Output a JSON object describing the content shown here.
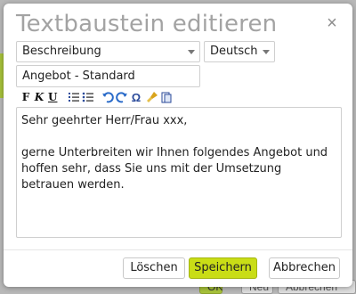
{
  "background": {
    "buttons": {
      "ok": "OK",
      "new": "Neu",
      "cancel": "Abbrechen"
    }
  },
  "dialog": {
    "title": "Textbaustein editieren",
    "close_glyph": "×",
    "field_select": {
      "value": "Beschreibung"
    },
    "language_select": {
      "value": "Deutsch"
    },
    "name_input": {
      "value": "Angebot - Standard"
    },
    "toolbar": {
      "bold": "F",
      "italic": "K",
      "underline": "U",
      "special_chars": "Ω",
      "icons": [
        "bold-icon",
        "italic-icon",
        "underline-icon",
        "ordered-list-icon",
        "bullet-list-icon",
        "undo-icon",
        "redo-icon",
        "special-char-icon",
        "clean-format-icon",
        "paste-icon"
      ]
    },
    "editor": {
      "line1": "Sehr geehrter Herr/Frau xxx,",
      "paragraph2": "gerne Unterbreiten wir Ihnen folgendes Angebot und hoffen sehr, dass Sie uns mit der Umsetzung betrauen werden."
    },
    "buttons": {
      "delete": "Löschen",
      "save": "Speichern",
      "cancel": "Abbrechen"
    },
    "colors": {
      "save_accent": "#c9dd16",
      "title": "#a3a3a3"
    }
  }
}
